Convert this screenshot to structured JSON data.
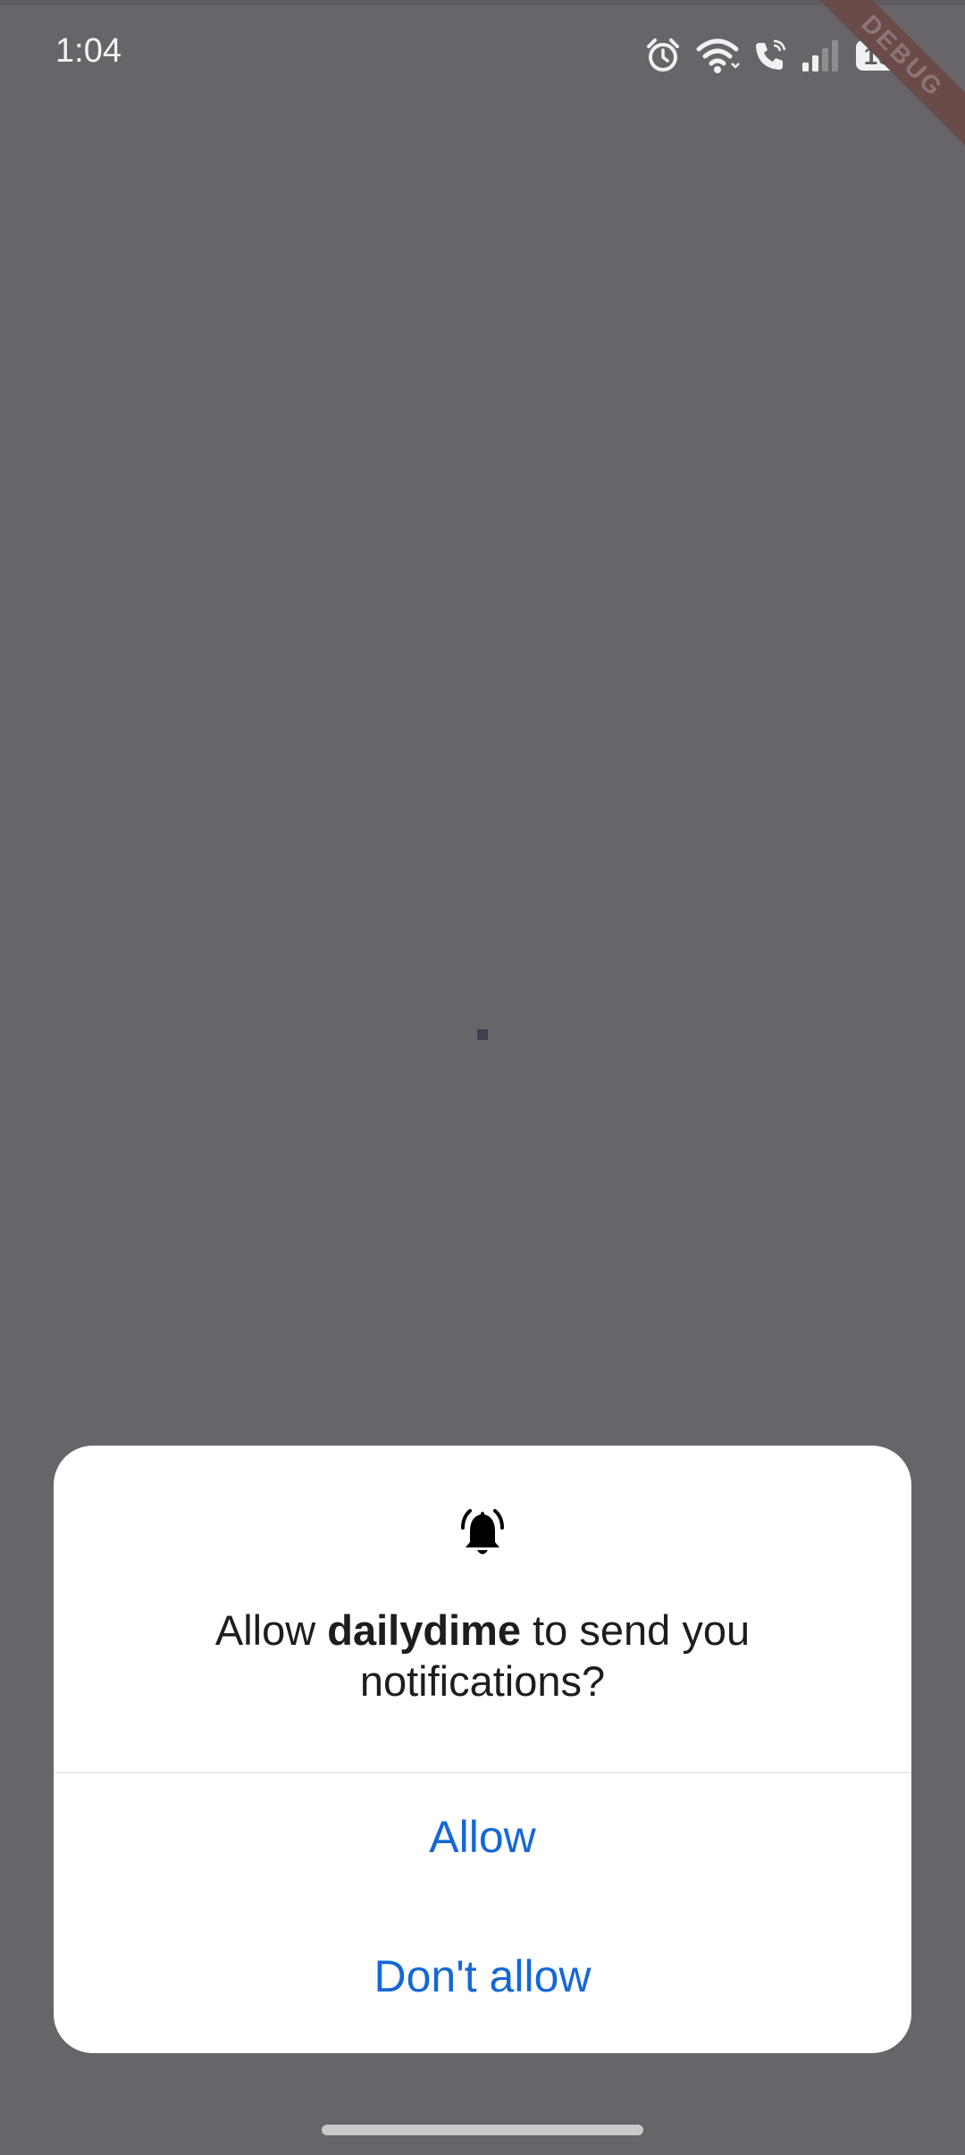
{
  "status_bar": {
    "time": "1:04",
    "battery_percent": "100",
    "battery_level": 1.0,
    "icons": [
      "alarm-icon",
      "wifi-icon",
      "wifi-calling-icon",
      "signal-icon",
      "battery-icon"
    ]
  },
  "debug_banner": {
    "label": "DEBUG"
  },
  "permission_dialog": {
    "icon": "bell-ringing-icon",
    "message_prefix": "Allow ",
    "app_name": "dailydime",
    "message_suffix": " to send you notifications?",
    "allow_label": "Allow",
    "deny_label": "Don't allow"
  },
  "colors": {
    "scrim": "#676569",
    "dialog_bg": "#ffffff",
    "accent": "#1667d6",
    "text": "#1d1c1f"
  }
}
